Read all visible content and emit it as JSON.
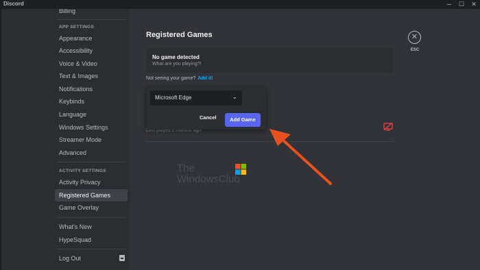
{
  "window": {
    "title": "Discord",
    "controls": [
      "─",
      "☐",
      "✕"
    ]
  },
  "sidebar": {
    "billing": "Billing",
    "app_settings_header": "APP SETTINGS",
    "app_settings": [
      "Appearance",
      "Accessibility",
      "Voice & Video",
      "Text & Images",
      "Notifications",
      "Keybinds",
      "Language",
      "Windows Settings",
      "Streamer Mode",
      "Advanced"
    ],
    "activity_settings_header": "ACTIVITY SETTINGS",
    "activity_settings": [
      "Activity Privacy",
      "Registered Games",
      "Game Overlay"
    ],
    "misc": [
      "What's New",
      "HypeSquad"
    ],
    "logout": "Log Out",
    "active_item": "Registered Games"
  },
  "main": {
    "title": "Registered Games",
    "no_game_title": "No game detected",
    "no_game_sub": "What are you playing?!",
    "not_seeing": "Not seeing your game?",
    "add_it": "Add it!",
    "last_played": "Last played 2 months ago",
    "overlay_icon": "overlay-disabled-icon",
    "close_icon": "✕",
    "esc": "ESC"
  },
  "popup": {
    "selected_option": "Microsoft Edge",
    "chevron": "⌄",
    "cancel": "Cancel",
    "add_game": "Add Game"
  },
  "watermark": {
    "line1": "The",
    "line2": "WindowsClub"
  },
  "colors": {
    "accent": "#5865f2",
    "link": "#00a8fc",
    "arrow": "#e8501e",
    "danger": "#f23f43"
  }
}
